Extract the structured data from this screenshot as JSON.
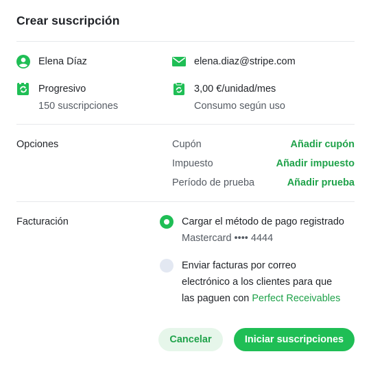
{
  "dialog": {
    "title": "Crear suscripción"
  },
  "customer": {
    "name": "Elena Díaz",
    "email": "elena.diaz@stripe.com",
    "plan": "Progresivo",
    "plan_count": "150 suscripciones",
    "price": "3,00 €/unidad/mes",
    "price_note": "Consumo según uso"
  },
  "options": {
    "label": "Opciones",
    "rows": [
      {
        "label": "Cupón",
        "action": "Añadir cupón"
      },
      {
        "label": "Impuesto",
        "action": "Añadir impuesto"
      },
      {
        "label": "Período de prueba",
        "action": "Añadir prueba"
      }
    ]
  },
  "billing": {
    "label": "Facturación",
    "option1_title": "Cargar el método de pago registrado",
    "option1_detail": "Mastercard •••• 4444",
    "option2_line1": "Enviar facturas por correo",
    "option2_line2": "electrónico a los clientes para que",
    "option2_line3_prefix": "las paguen con",
    "option2_link": "Perfect Receivables",
    "selected": "option1"
  },
  "actions": {
    "cancel": "Cancelar",
    "submit": "Iniciar suscripciones"
  },
  "colors": {
    "accent": "#1fbe55",
    "accent_text": "#1fa24a",
    "divider": "#e6e8eb"
  },
  "icons": {
    "name": "user-circle-icon",
    "email": "envelope-icon",
    "plan": "subscription-icon",
    "price": "pricing-clipboard-icon"
  }
}
